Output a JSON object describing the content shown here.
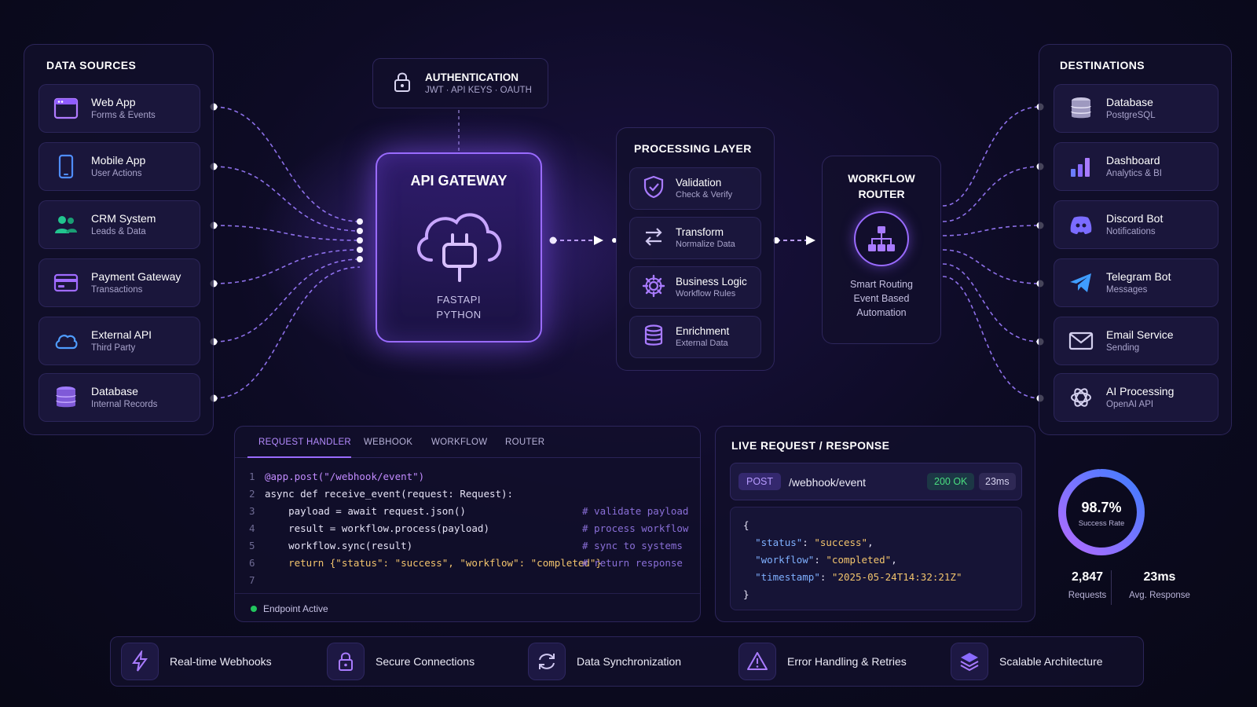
{
  "sources": {
    "title": "DATA SOURCES",
    "items": [
      {
        "title": "Web App",
        "subtitle": "Forms & Events",
        "icon": "browser-window-icon"
      },
      {
        "title": "Mobile App",
        "subtitle": "User Actions",
        "icon": "smartphone-icon"
      },
      {
        "title": "CRM System",
        "subtitle": "Leads & Data",
        "icon": "users-icon"
      },
      {
        "title": "Payment Gateway",
        "subtitle": "Transactions",
        "icon": "credit-card-icon"
      },
      {
        "title": "External API",
        "subtitle": "Third Party",
        "icon": "cloud-icon"
      },
      {
        "title": "Database",
        "subtitle": "Internal Records",
        "icon": "database-icon"
      }
    ]
  },
  "auth": {
    "title": "AUTHENTICATION",
    "subtitle": "JWT · API KEYS · OAUTH"
  },
  "gateway": {
    "title": "API GATEWAY",
    "line1": "FASTAPI",
    "line2": "PYTHON"
  },
  "processing": {
    "title": "PROCESSING LAYER",
    "items": [
      {
        "title": "Validation",
        "subtitle": "Check & Verify",
        "icon": "shield-check-icon"
      },
      {
        "title": "Transform",
        "subtitle": "Normalize Data",
        "icon": "swap-arrows-icon"
      },
      {
        "title": "Business Logic",
        "subtitle": "Workflow Rules",
        "icon": "gear-icon"
      },
      {
        "title": "Enrichment",
        "subtitle": "External Data",
        "icon": "database-icon"
      }
    ]
  },
  "router": {
    "title_line1": "WORKFLOW",
    "title_line2": "ROUTER",
    "desc1": "Smart Routing",
    "desc2": "Event Based",
    "desc3": "Automation"
  },
  "destinations": {
    "title": "DESTINATIONS",
    "items": [
      {
        "title": "Database",
        "subtitle": "PostgreSQL",
        "icon": "database-icon"
      },
      {
        "title": "Dashboard",
        "subtitle": "Analytics & BI",
        "icon": "bar-chart-icon"
      },
      {
        "title": "Discord Bot",
        "subtitle": "Notifications",
        "icon": "discord-icon"
      },
      {
        "title": "Telegram Bot",
        "subtitle": "Messages",
        "icon": "telegram-icon"
      },
      {
        "title": "Email Service",
        "subtitle": "Sending",
        "icon": "envelope-icon"
      },
      {
        "title": "AI Processing",
        "subtitle": "OpenAI API",
        "icon": "openai-icon"
      }
    ]
  },
  "code_panel": {
    "tabs": [
      "REQUEST HANDLER",
      "WEBHOOK",
      "WORKFLOW",
      "ROUTER"
    ],
    "active_tab": 0,
    "lines": [
      {
        "n": "1",
        "code": "@app.post(\"/webhook/event\")",
        "comment": ""
      },
      {
        "n": "2",
        "code": "async def receive_event(request: Request):",
        "comment": ""
      },
      {
        "n": "3",
        "code": "    payload = await request.json()",
        "comment": "# validate payload"
      },
      {
        "n": "4",
        "code": "    result = workflow.process(payload)",
        "comment": "# process workflow"
      },
      {
        "n": "5",
        "code": "    workflow.sync(result)",
        "comment": "# sync to systems"
      },
      {
        "n": "6",
        "code": "    return {\"status\": \"success\", \"workflow\": \"completed\"}",
        "comment": "# return response"
      },
      {
        "n": "7",
        "code": "",
        "comment": ""
      }
    ],
    "status": "Endpoint Active"
  },
  "live": {
    "title": "LIVE REQUEST / RESPONSE",
    "method": "POST",
    "path": "/webhook/event",
    "status": "200 OK",
    "latency": "23ms",
    "json_open": "{",
    "json_close": "}",
    "json": [
      {
        "key": "\"status\"",
        "value": "\"success\"",
        "comma": ","
      },
      {
        "key": "\"workflow\"",
        "value": "\"completed\"",
        "comma": ","
      },
      {
        "key": "\"timestamp\"",
        "value": "\"2025-05-24T14:32:21Z\"",
        "comma": ""
      }
    ]
  },
  "stats": {
    "success_rate": "98.7%",
    "success_label": "Success Rate",
    "success_fraction": 0.987,
    "requests": "2,847",
    "requests_label": "Requests",
    "avg": "23ms",
    "avg_label": "Avg. Response"
  },
  "features": [
    {
      "label": "Real-time Webhooks",
      "icon": "lightning-icon"
    },
    {
      "label": "Secure Connections",
      "icon": "lock-icon"
    },
    {
      "label": "Data Synchronization",
      "icon": "sync-icon"
    },
    {
      "label": "Error Handling & Retries",
      "icon": "warning-icon"
    },
    {
      "label": "Scalable Architecture",
      "icon": "layers-icon"
    }
  ],
  "colors": {
    "accent": "#9a6bff",
    "accent_blue": "#4f8dff",
    "success": "#22c55e",
    "background": "#0d0b24"
  }
}
